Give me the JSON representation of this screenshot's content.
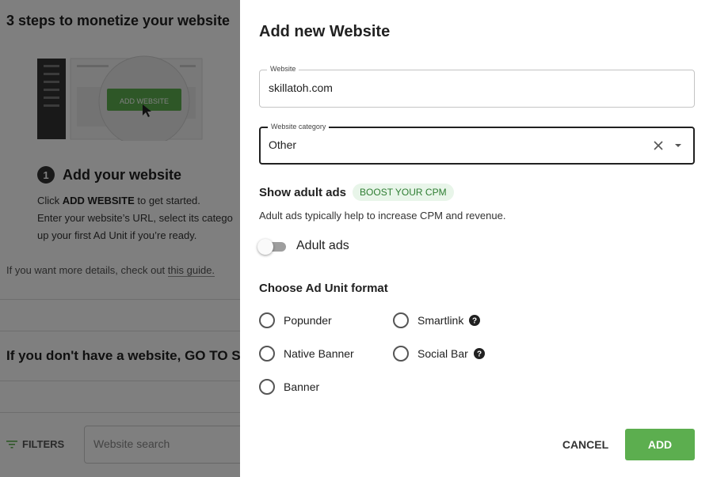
{
  "background": {
    "title": "3 steps to monetize your website",
    "illustration_button": "ADD WEBSITE",
    "step": {
      "number": "1",
      "title": "Add your website",
      "line1_prefix": "Click ",
      "line1_bold": "ADD WEBSITE",
      "line1_suffix": " to get started.",
      "line2": "Enter your website’s URL, select its catego",
      "line3": "up your first Ad Unit if you’re ready."
    },
    "guide_prefix": "If you want more details, check out ",
    "guide_link": "this guide.",
    "cta": "If you don't have a website, GO TO SM",
    "filters_label": "FILTERS",
    "search_placeholder": "Website search"
  },
  "dialog": {
    "title": "Add new Website",
    "website_field": {
      "label": "Website",
      "value": "skillatoh.com"
    },
    "category_field": {
      "label": "Website category",
      "value": "Other"
    },
    "adult": {
      "title": "Show adult ads",
      "badge": "BOOST YOUR CPM",
      "description": "Adult ads typically help to increase CPM and revenue.",
      "toggle_label": "Adult ads",
      "toggle_on": false
    },
    "format": {
      "title": "Choose Ad Unit format",
      "options": [
        "Popunder",
        "Smartlink",
        "Native Banner",
        "Social Bar",
        "Banner"
      ]
    },
    "cancel_label": "CANCEL",
    "add_label": "ADD"
  },
  "colors": {
    "accent": "#5cae4f",
    "badge_bg": "#e8f5e9",
    "badge_text": "#2e7d32",
    "overlay": "rgba(0,0,0,0.5)"
  },
  "icons": [
    "filter-icon",
    "clear-icon",
    "chevron-down-icon",
    "help-icon",
    "cursor-icon"
  ]
}
